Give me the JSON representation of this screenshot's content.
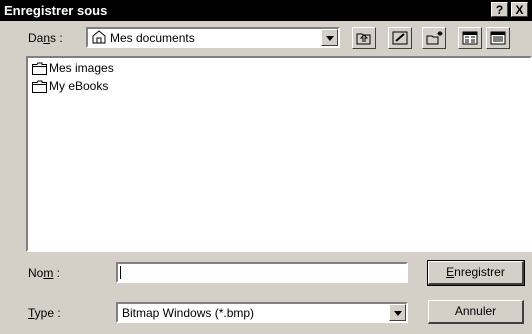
{
  "window": {
    "title": "Enregistrer sous",
    "help_label": "?",
    "close_label": "X"
  },
  "toolbar": {
    "location_label_pre": "Da",
    "location_label_accel": "n",
    "location_label_post": "s :",
    "location_value": "Mes documents",
    "buttons": [
      "up-one-level-icon",
      "desktop-icon",
      "new-folder-icon",
      "list-view-icon",
      "details-view-icon"
    ]
  },
  "files": [
    {
      "name": "Mes images",
      "icon": "folder-icon"
    },
    {
      "name": "My eBooks",
      "icon": "folder-icon"
    }
  ],
  "form": {
    "name_label_pre": "No",
    "name_label_accel": "m",
    "name_label_post": " :",
    "name_value": "",
    "type_label_accel": "T",
    "type_label_post": "ype :",
    "type_value": "Bitmap Windows (*.bmp)"
  },
  "actions": {
    "save_accel": "E",
    "save_post": "nregistrer",
    "cancel_label": "Annuler"
  }
}
